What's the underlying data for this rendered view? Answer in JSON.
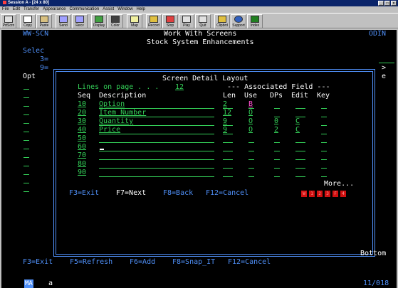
{
  "window": {
    "title": "Session A - [24 x 80]",
    "controls": [
      "_",
      "□",
      "×"
    ]
  },
  "menu": [
    "File",
    "Edit",
    "Transfer",
    "Appearance",
    "Communication",
    "Assist",
    "Window",
    "Help"
  ],
  "toolbar": [
    "PrtScrn",
    "Copy",
    "Paste",
    "Send",
    "Recv",
    "Display",
    "Color",
    "Map",
    "Record",
    "Stop",
    "Play",
    "Quit",
    "Clipbrd",
    "Support",
    "Index"
  ],
  "screen": {
    "id": "WW-SCN",
    "title": "Work With Screens",
    "subtitle": "Stock System Enhancements",
    "system": "ODIN",
    "bg_select": "Selec",
    "bg_3": "3=",
    "bg_9": "9=",
    "bg_opt": "Opt",
    "bg_more": ">",
    "bg_e": "e",
    "bottom": "Bottom",
    "function_keys": [
      "F3=Exit",
      "F5=Refresh",
      "F6=Add",
      "F8=Snap_IT",
      "F12=Cancel"
    ]
  },
  "popup": {
    "title": "Screen Detail Layout",
    "lines_label": "Lines on page . . .",
    "lines_value": "12",
    "assoc_header": "--- Associated Field ---",
    "headers": [
      "Seq",
      "Description",
      "Len",
      "Use",
      "DPs",
      "Edit",
      "Key"
    ],
    "rows": [
      {
        "seq": "10",
        "desc": "Option",
        "len": "2",
        "use": "B",
        "dps": "",
        "edit": "",
        "key": ""
      },
      {
        "seq": "20",
        "desc": "Item Number",
        "len": "12",
        "use": "O",
        "dps": "",
        "edit": "",
        "key": ""
      },
      {
        "seq": "30",
        "desc": "Quantity",
        "len": "9",
        "use": "O",
        "dps": "0",
        "edit": "C",
        "key": ""
      },
      {
        "seq": "40",
        "desc": "Price",
        "len": "9",
        "use": "O",
        "dps": "2",
        "edit": "C",
        "key": ""
      },
      {
        "seq": "50",
        "desc": "",
        "len": "",
        "use": "",
        "dps": "",
        "edit": "",
        "key": ""
      },
      {
        "seq": "60",
        "desc": "",
        "len": "",
        "use": "",
        "dps": "",
        "edit": "",
        "key": ""
      },
      {
        "seq": "70",
        "desc": "",
        "len": "",
        "use": "",
        "dps": "",
        "edit": "",
        "key": ""
      },
      {
        "seq": "80",
        "desc": "",
        "len": "",
        "use": "",
        "dps": "",
        "edit": "",
        "key": ""
      },
      {
        "seq": "90",
        "desc": "",
        "len": "",
        "use": "",
        "dps": "",
        "edit": "",
        "key": ""
      }
    ],
    "more": "More...",
    "function_keys": [
      "F3=Exit",
      "F7=Next",
      "F8=Back",
      "F12=Cancel"
    ],
    "pf_indicators": [
      "W",
      "1",
      "2",
      "3",
      "F",
      "4"
    ]
  },
  "status": {
    "mode": "MA",
    "input": "a",
    "cursor": "11/018"
  },
  "colors": {
    "green": "#34d058",
    "white": "#ffffff",
    "blue": "#4f8ff7",
    "pink": "#ff4fd0",
    "red": "#ff3b3b",
    "black": "#000000"
  }
}
